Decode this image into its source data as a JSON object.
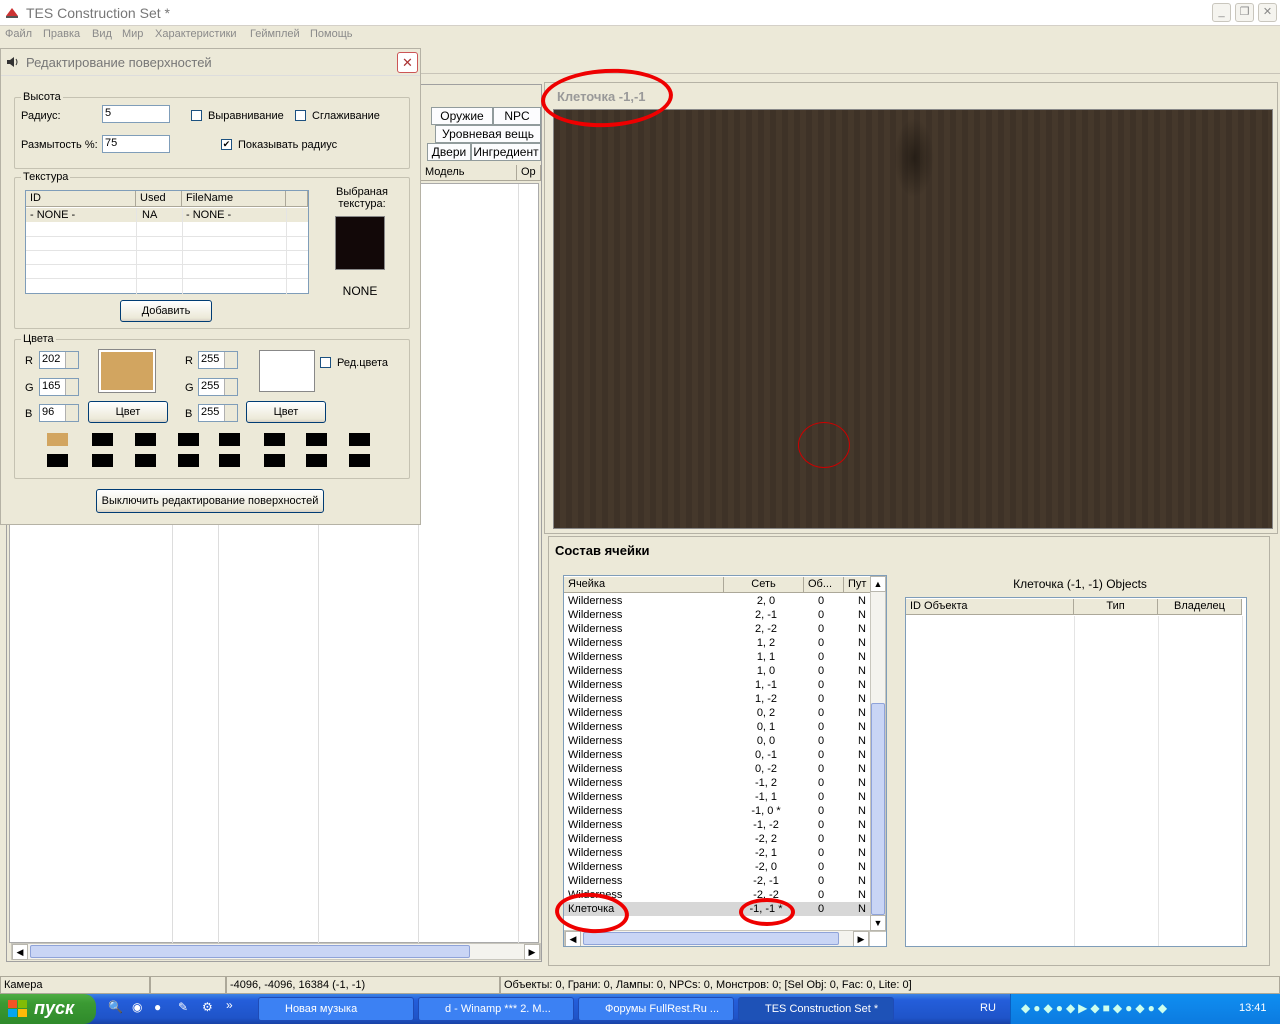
{
  "app": {
    "title": "TES Construction Set *"
  },
  "menu": [
    "Файл",
    "Правка",
    "Вид",
    "Мир",
    "Характеристики",
    "Геймплей",
    "Помощь"
  ],
  "dialog": {
    "title": "Редактирование поверхностей",
    "height_group": "Высота",
    "radius_label": "Радиус:",
    "radius_value": "5",
    "flatten_label": "Выравнивание",
    "smooth_label": "Сглаживание",
    "blur_label": "Размытость %:",
    "blur_value": "75",
    "show_radius_label": "Показывать радиус",
    "show_radius_checked": "✔",
    "texture_group": "Текстура",
    "tex_headers": [
      "ID",
      "Used",
      "FileName"
    ],
    "tex_row": [
      "- NONE -",
      "NA",
      "- NONE -"
    ],
    "selected_texture_label": "Выбраная текстура:",
    "selected_texture_name": "NONE",
    "add_button": "Добавить",
    "colors_group": "Цвета",
    "r1": "202",
    "g1": "165",
    "b1": "96",
    "r2": "255",
    "g2": "255",
    "b2": "255",
    "r_label": "R",
    "g_label": "G",
    "b_label": "B",
    "color_button": "Цвет",
    "edit_colors_label": "Ред.цвета",
    "swatch1": "#d2a560",
    "disable_button": "Выключить редактирование поверхностей"
  },
  "object_tabs": [
    "Оружие",
    "NPC",
    "Уровневая вещь",
    "Двери",
    "Ингредиент"
  ],
  "object_list_headers": [
    "Модель",
    "Ор"
  ],
  "render_window": {
    "title": "Клеточка -1,-1"
  },
  "cell_view": {
    "title": "Состав ячейки",
    "headers": [
      "Ячейка",
      "Сеть",
      "Об...",
      "Пут"
    ],
    "rows": [
      [
        "Wilderness",
        "2, 0",
        "0",
        "N"
      ],
      [
        "Wilderness",
        "2, -1",
        "0",
        "N"
      ],
      [
        "Wilderness",
        "2, -2",
        "0",
        "N"
      ],
      [
        "Wilderness",
        "1, 2",
        "0",
        "N"
      ],
      [
        "Wilderness",
        "1, 1",
        "0",
        "N"
      ],
      [
        "Wilderness",
        "1, 0",
        "0",
        "N"
      ],
      [
        "Wilderness",
        "1, -1",
        "0",
        "N"
      ],
      [
        "Wilderness",
        "1, -2",
        "0",
        "N"
      ],
      [
        "Wilderness",
        "0, 2",
        "0",
        "N"
      ],
      [
        "Wilderness",
        "0, 1",
        "0",
        "N"
      ],
      [
        "Wilderness",
        "0, 0",
        "0",
        "N"
      ],
      [
        "Wilderness",
        "0, -1",
        "0",
        "N"
      ],
      [
        "Wilderness",
        "0, -2",
        "0",
        "N"
      ],
      [
        "Wilderness",
        "-1, 2",
        "0",
        "N"
      ],
      [
        "Wilderness",
        "-1, 1",
        "0",
        "N"
      ],
      [
        "Wilderness",
        "-1, 0 *",
        "0",
        "N"
      ],
      [
        "Wilderness",
        "-1, -2",
        "0",
        "N"
      ],
      [
        "Wilderness",
        "-2, 2",
        "0",
        "N"
      ],
      [
        "Wilderness",
        "-2, 1",
        "0",
        "N"
      ],
      [
        "Wilderness",
        "-2, 0",
        "0",
        "N"
      ],
      [
        "Wilderness",
        "-2, -1",
        "0",
        "N"
      ],
      [
        "Wilderness",
        "-2, -2",
        "0",
        "N"
      ],
      [
        "Клеточка",
        "-1, -1 *",
        "0",
        "N"
      ]
    ],
    "objects_title": "Клеточка (-1, -1) Objects",
    "objects_headers": [
      "ID Объекта",
      "Тип",
      "Владелец"
    ]
  },
  "status": {
    "camera": "Камера",
    "coords": "-4096, -4096, 16384 (-1, -1)",
    "info": "Объекты: 0, Грани: 0, Лампы:  0, NPCs: 0, Монстров:  0; [Sel Obj: 0, Fac: 0, Lite: 0]"
  },
  "taskbar": {
    "start": "пуск",
    "buttons": [
      "Новая музыка",
      "d - Winamp *** 2. M...",
      "Форумы FullRest.Ru ...",
      "TES Construction Set *"
    ],
    "lang": "RU",
    "time": "13:41"
  }
}
